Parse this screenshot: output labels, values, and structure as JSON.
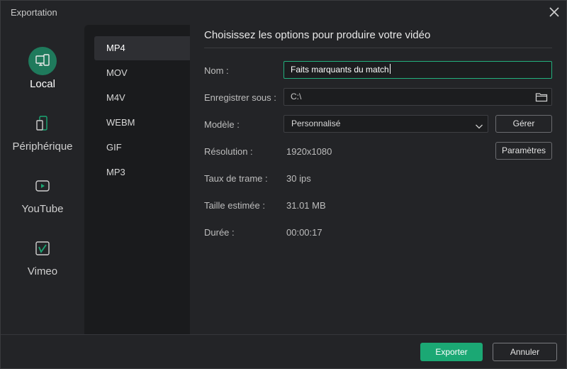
{
  "window": {
    "title": "Exportation"
  },
  "destinations": [
    {
      "label": "Local",
      "icon": "computer-phone-icon"
    },
    {
      "label": "Périphérique",
      "icon": "device-icon"
    },
    {
      "label": "YouTube",
      "icon": "youtube-icon"
    },
    {
      "label": "Vimeo",
      "icon": "vimeo-icon"
    }
  ],
  "formats": [
    "MP4",
    "MOV",
    "M4V",
    "WEBM",
    "GIF",
    "MP3"
  ],
  "main": {
    "heading": "Choisissez les options pour produire votre vidéo",
    "name_label": "Nom :",
    "name_value": "Faits marquants du match",
    "save_label": "Enregistrer sous :",
    "save_value": "C:\\",
    "model_label": "Modèle :",
    "model_value": "Personnalisé",
    "manage_button": "Gérer",
    "resolution_label": "Résolution :",
    "resolution_value": "1920x1080",
    "settings_button": "Paramètres",
    "framerate_label": "Taux de trame :",
    "framerate_value": "30 ips",
    "size_label": "Taille estimée :",
    "size_value": "31.01 MB",
    "duration_label": "Durée :",
    "duration_value": "00:00:17"
  },
  "footer": {
    "export_button": "Exporter",
    "cancel_button": "Annuler"
  },
  "colors": {
    "accent": "#1ba874",
    "focus_border": "#22b07d",
    "background": "#232427",
    "panel": "#1a1b1d"
  }
}
